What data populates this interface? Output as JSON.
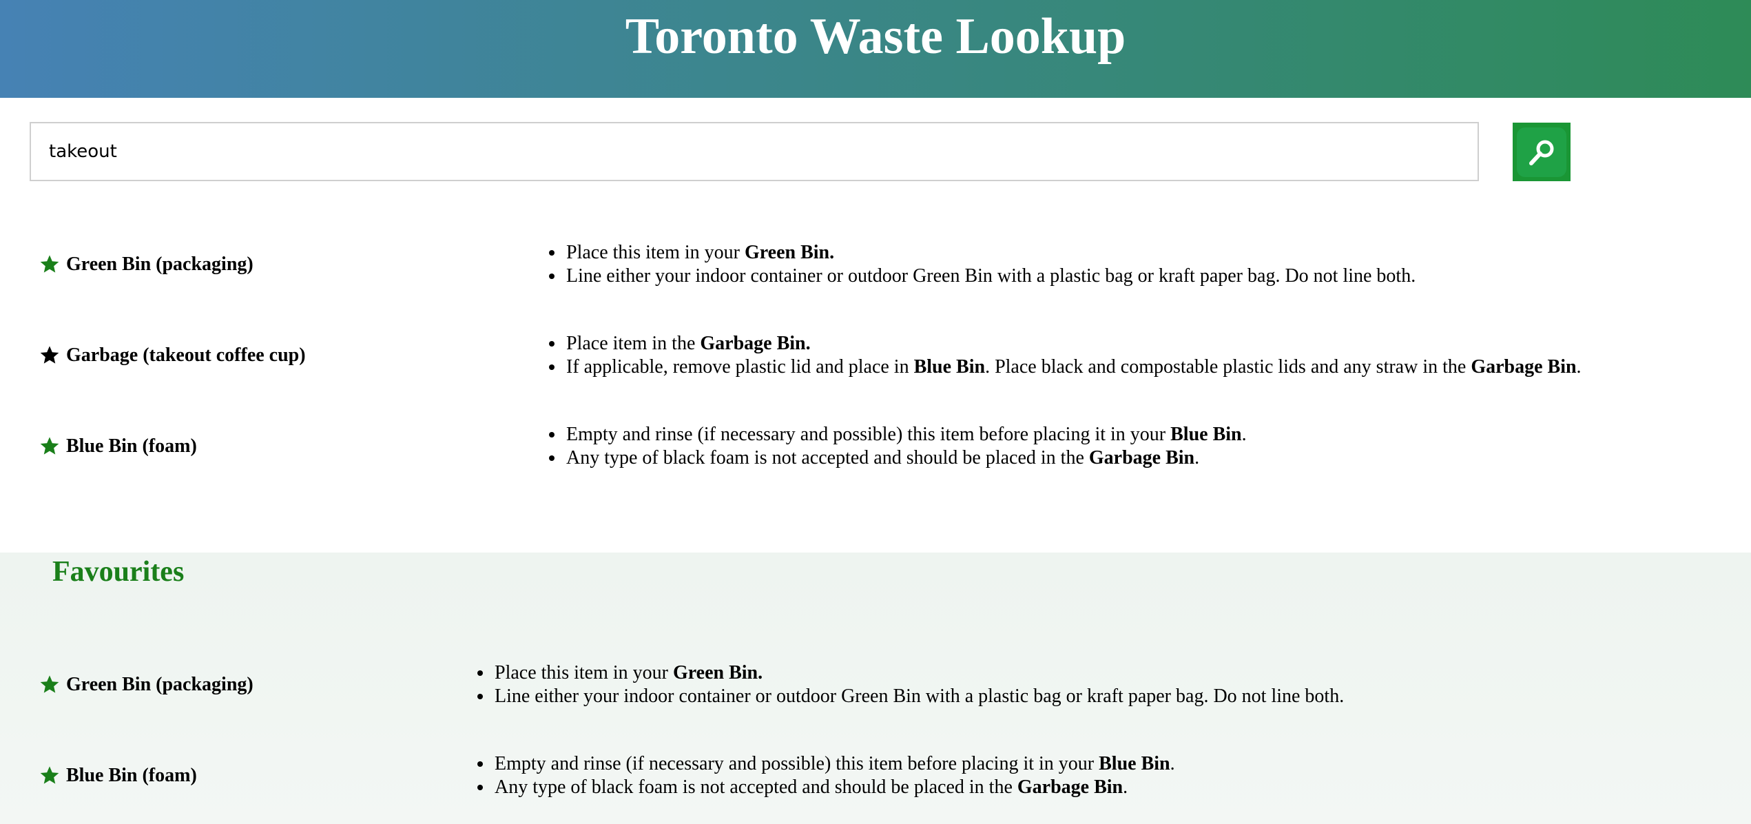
{
  "header": {
    "title": "Toronto Waste Lookup"
  },
  "search": {
    "value": "takeout"
  },
  "colors": {
    "favourite_star": "#1a7f1a",
    "unfavourite_star": "#000000"
  },
  "results": [
    {
      "title": "Green Bin (packaging)",
      "favourite": true,
      "lines": [
        [
          {
            "t": "Place this item in your "
          },
          {
            "t": "Green Bin.",
            "b": true
          }
        ],
        [
          {
            "t": "Line either your indoor container or outdoor Green Bin with a plastic bag or kraft paper bag. Do not line both."
          }
        ]
      ]
    },
    {
      "title": "Garbage (takeout coffee cup)",
      "favourite": false,
      "lines": [
        [
          {
            "t": "Place item in the "
          },
          {
            "t": "Garbage Bin.",
            "b": true
          }
        ],
        [
          {
            "t": "If applicable, remove plastic lid and place in "
          },
          {
            "t": "Blue Bin",
            "b": true
          },
          {
            "t": ". Place black and compostable plastic lids and any straw in the "
          },
          {
            "t": "Garbage Bin",
            "b": true
          },
          {
            "t": "."
          }
        ]
      ]
    },
    {
      "title": "Blue Bin (foam)",
      "favourite": true,
      "lines": [
        [
          {
            "t": "Empty and rinse (if necessary and possible) this item before placing it in your "
          },
          {
            "t": "Blue Bin",
            "b": true
          },
          {
            "t": "."
          }
        ],
        [
          {
            "t": "Any type of black foam is not accepted and should be placed in the "
          },
          {
            "t": "Garbage Bin",
            "b": true
          },
          {
            "t": "."
          }
        ]
      ]
    }
  ],
  "favourites": {
    "heading": "Favourites",
    "items": [
      {
        "title": "Green Bin (packaging)",
        "favourite": true,
        "lines": [
          [
            {
              "t": "Place this item in your "
            },
            {
              "t": "Green Bin.",
              "b": true
            }
          ],
          [
            {
              "t": "Line either your indoor container or outdoor Green Bin with a plastic bag or kraft paper bag. Do not line both."
            }
          ]
        ]
      },
      {
        "title": "Blue Bin (foam)",
        "favourite": true,
        "lines": [
          [
            {
              "t": "Empty and rinse (if necessary and possible) this item before placing it in your "
            },
            {
              "t": "Blue Bin",
              "b": true
            },
            {
              "t": "."
            }
          ],
          [
            {
              "t": "Any type of black foam is not accepted and should be placed in the "
            },
            {
              "t": "Garbage Bin",
              "b": true
            },
            {
              "t": "."
            }
          ]
        ]
      }
    ]
  }
}
